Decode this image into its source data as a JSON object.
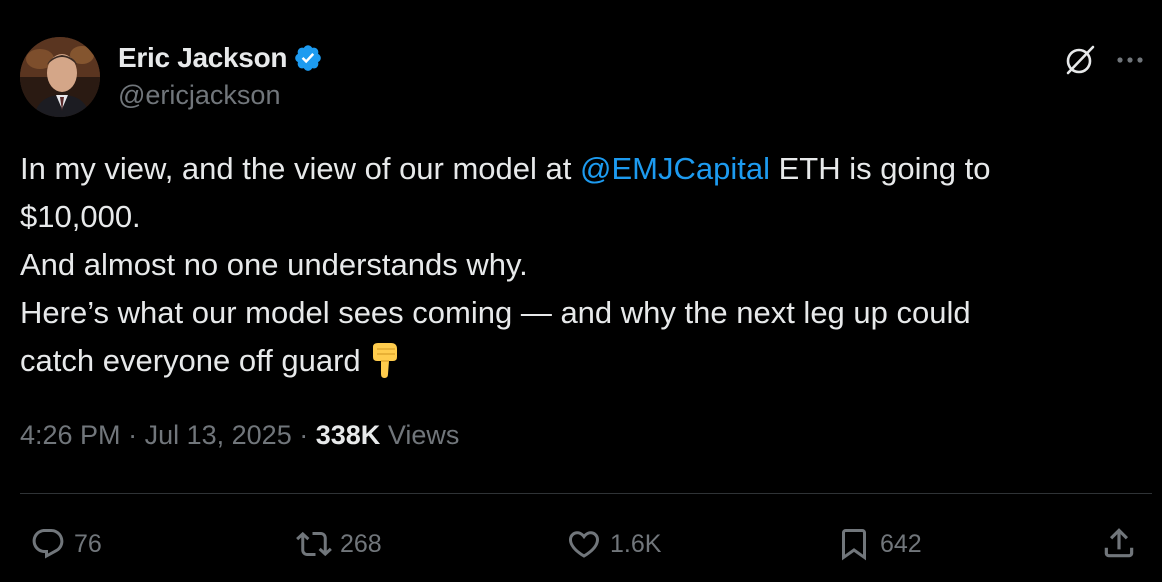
{
  "author": {
    "display_name": "Eric Jackson",
    "handle": "@ericjackson",
    "verified_icon": "verified-badge-icon",
    "avatar": "avatar-photo"
  },
  "header_icons": {
    "grok": "grok-icon",
    "more": "more-options-icon"
  },
  "tweet": {
    "line1_pre": "In my view, and the view of our model at ",
    "mention": "@EMJCapital",
    "line1_post": " ETH is going to",
    "line2": "$10,000.",
    "line3": "And almost no one understands why.",
    "line4": "Here’s what our model sees coming — and why the next leg up could",
    "line5": "catch everyone off guard",
    "emoji": "backhand-index-pointing-down-icon"
  },
  "meta": {
    "time": "4:26 PM",
    "separator": "·",
    "date": "Jul 13, 2025",
    "views_count": "338K",
    "views_label": "Views"
  },
  "actions": {
    "replies": "76",
    "reposts": "268",
    "likes": "1.6K",
    "bookmarks": "642"
  },
  "colors": {
    "background": "#000000",
    "text": "#e7e9ea",
    "muted": "#71767b",
    "link": "#1d9bf0",
    "divider": "#2f3336",
    "verified": "#1d9bf0"
  }
}
